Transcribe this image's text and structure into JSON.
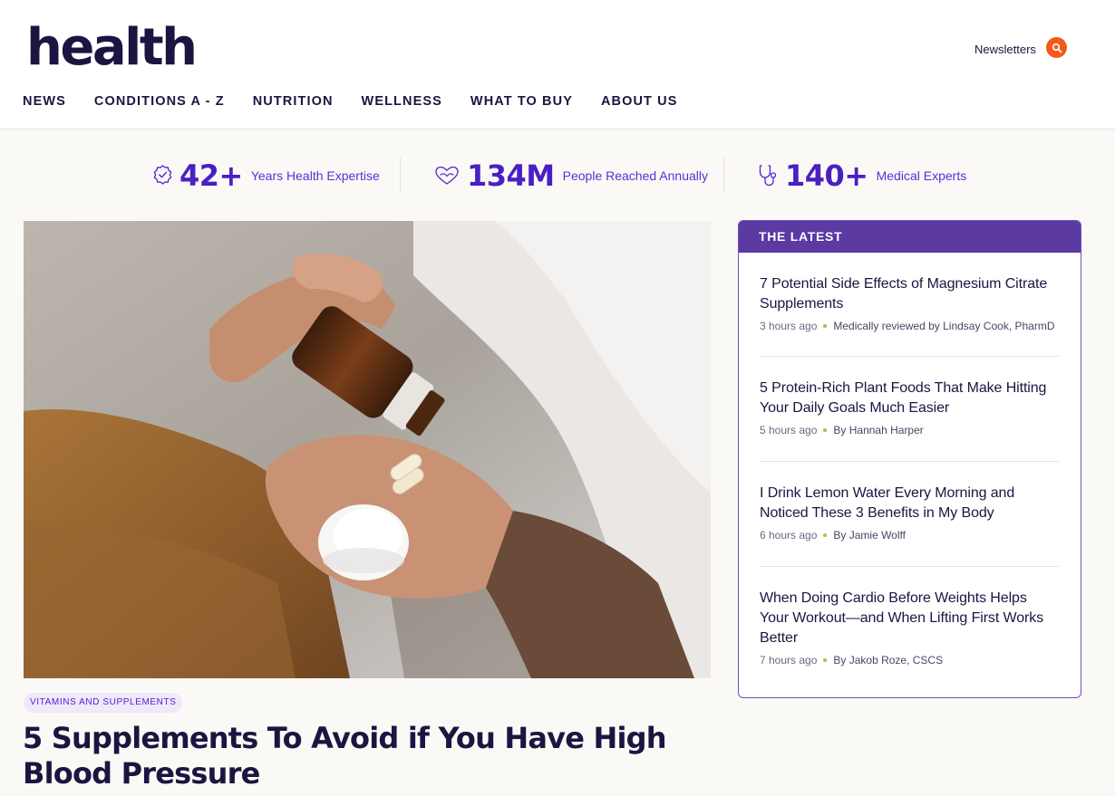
{
  "header": {
    "logo": "health",
    "newsletters": "Newsletters",
    "search_icon": "search-icon",
    "nav": [
      "NEWS",
      "CONDITIONS A - Z",
      "NUTRITION",
      "WELLNESS",
      "WHAT TO BUY",
      "ABOUT US"
    ]
  },
  "stats": [
    {
      "icon": "award-badge-icon",
      "value": "42+",
      "label": "Years Health Expertise"
    },
    {
      "icon": "heart-hands-icon",
      "value": "134M",
      "label": "People Reached Annually"
    },
    {
      "icon": "stethoscope-icon",
      "value": "140+",
      "label": "Medical Experts"
    }
  ],
  "hero": {
    "category": "VITAMINS AND SUPPLEMENTS",
    "headline": "5 Supplements To Avoid if You Have High Blood Pressure"
  },
  "latest": {
    "heading": "THE LATEST",
    "items": [
      {
        "title": "7 Potential Side Effects of Magnesium Citrate Supplements",
        "time": "3 hours ago",
        "byline": "Medically reviewed by Lindsay Cook, PharmD"
      },
      {
        "title": "5 Protein-Rich Plant Foods That Make Hitting Your Daily Goals Much Easier",
        "time": "5 hours ago",
        "byline": "By Hannah Harper"
      },
      {
        "title": "I Drink Lemon Water Every Morning and Noticed These 3 Benefits in My Body",
        "time": "6 hours ago",
        "byline": "By Jamie Wolff"
      },
      {
        "title": "When Doing Cardio Before Weights Helps Your Workout—and When Lifting First Works Better",
        "time": "7 hours ago",
        "byline": "By Jakob Roze, CSCS"
      }
    ]
  },
  "colors": {
    "brand_purple": "#5320d2",
    "navy": "#1c1541",
    "search_orange": "#f25a1b",
    "latest_header": "#5b3aa2"
  }
}
